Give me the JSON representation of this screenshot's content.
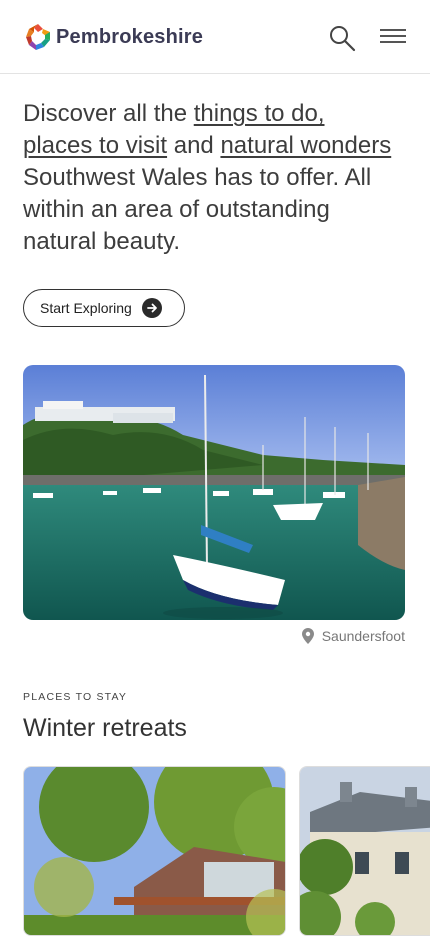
{
  "header": {
    "brand": "Pembrokeshire",
    "icons": {
      "search": "search-icon",
      "menu": "menu-icon",
      "logo": "logo-icon"
    }
  },
  "intro": {
    "text_1": "Discover all the ",
    "link_1": "things to do,",
    "text_2": " ",
    "link_2": "places to visit",
    "text_3": " and ",
    "link_3": "natural wonders",
    "text_4": " Southwest Wales has to offer. All within an area of outstanding natural beauty."
  },
  "cta": {
    "label": "Start Exploring",
    "icon": "arrow-right-icon"
  },
  "hero": {
    "location": "Saundersfoot",
    "icon": "map-pin-icon"
  },
  "stay": {
    "eyebrow": "PLACES TO STAY",
    "title": "Winter retreats"
  },
  "colors": {
    "text": "#3d3d3d",
    "brand_text": "#3b3b55",
    "water": "#1f7a76"
  }
}
